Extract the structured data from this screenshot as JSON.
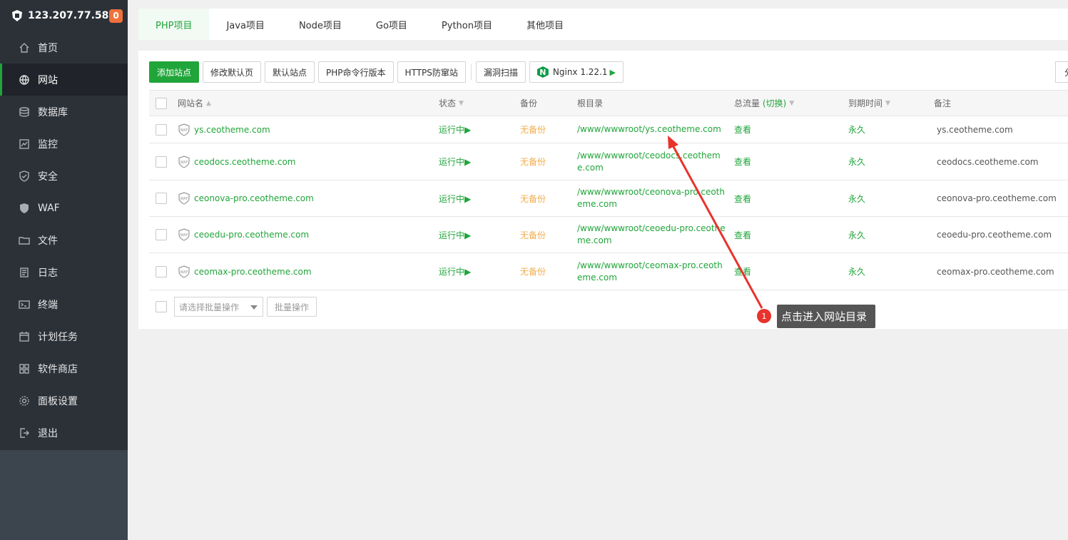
{
  "sidebar": {
    "host": "123.207.77.58",
    "badge": "0",
    "items": [
      {
        "label": "首页",
        "icon": "home-icon"
      },
      {
        "label": "网站",
        "icon": "globe-icon",
        "active": true
      },
      {
        "label": "数据库",
        "icon": "database-icon"
      },
      {
        "label": "监控",
        "icon": "monitor-icon"
      },
      {
        "label": "安全",
        "icon": "shield-icon"
      },
      {
        "label": "WAF",
        "icon": "waf-shield-icon"
      },
      {
        "label": "文件",
        "icon": "folder-icon"
      },
      {
        "label": "日志",
        "icon": "log-icon"
      },
      {
        "label": "终端",
        "icon": "terminal-icon"
      },
      {
        "label": "计划任务",
        "icon": "calendar-icon"
      },
      {
        "label": "软件商店",
        "icon": "grid-icon"
      },
      {
        "label": "面板设置",
        "icon": "gear-icon"
      },
      {
        "label": "退出",
        "icon": "logout-icon"
      }
    ]
  },
  "tabs": [
    "PHP项目",
    "Java项目",
    "Node项目",
    "Go项目",
    "Python项目",
    "其他项目"
  ],
  "toolbar": {
    "add_site": "添加站点",
    "edit_default": "修改默认页",
    "default_site": "默认站点",
    "php_cli": "PHP命令行版本",
    "https_guard": "HTTPS防窜站",
    "vuln_scan": "漏洞扫描",
    "nginx": "Nginx 1.22.1",
    "right_partial": "分"
  },
  "table": {
    "headers": {
      "name": "网站名",
      "status": "状态",
      "backup": "备份",
      "root": "根目录",
      "flow": "总流量",
      "flow_switch": "(切换)",
      "expire": "到期时间",
      "note": "备注"
    },
    "rows": [
      {
        "name": "ys.ceotheme.com",
        "status": "运行中▶",
        "backup": "无备份",
        "root": "/www/wwwroot/ys.ceotheme.com",
        "flow": "查看",
        "expire": "永久",
        "note": "ys.ceotheme.com"
      },
      {
        "name": "ceodocs.ceotheme.com",
        "status": "运行中▶",
        "backup": "无备份",
        "root": "/www/wwwroot/ceodocs.ceotheme.com",
        "flow": "查看",
        "expire": "永久",
        "note": "ceodocs.ceotheme.com"
      },
      {
        "name": "ceonova-pro.ceotheme.com",
        "status": "运行中▶",
        "backup": "无备份",
        "root": "/www/wwwroot/ceonova-pro.ceotheme.com",
        "flow": "查看",
        "expire": "永久",
        "note": "ceonova-pro.ceotheme.com"
      },
      {
        "name": "ceoedu-pro.ceotheme.com",
        "status": "运行中▶",
        "backup": "无备份",
        "root": "/www/wwwroot/ceoedu-pro.ceotheme.com",
        "flow": "查看",
        "expire": "永久",
        "note": "ceoedu-pro.ceotheme.com"
      },
      {
        "name": "ceomax-pro.ceotheme.com",
        "status": "运行中▶",
        "backup": "无备份",
        "root": "/www/wwwroot/ceomax-pro.ceotheme.com",
        "flow": "查看",
        "expire": "永久",
        "note": "ceomax-pro.ceotheme.com"
      }
    ]
  },
  "batch": {
    "placeholder": "请选择批量操作",
    "button": "批量操作"
  },
  "annotation": {
    "number": "1",
    "text": "点击进入网站目录"
  },
  "colors": {
    "accent": "#20a53a",
    "sidebar_bg": "#2c3138",
    "warning": "#f0ad4e",
    "annotation_red": "#e8332c"
  }
}
